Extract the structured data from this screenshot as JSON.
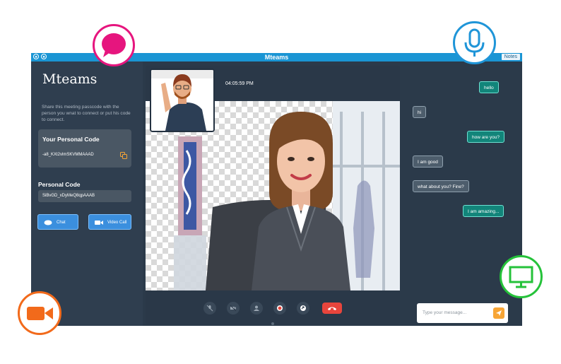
{
  "window": {
    "title": "Mteams",
    "notes_label": "Notes"
  },
  "sidebar": {
    "logo": "Mteams",
    "share_text": "Share this meeting passcode with the person you wnat to connect or put his code to connect.",
    "your_code_label": "Your Personal Code",
    "your_code_value": "-a8_KXt2vlmSKVMMAAAD",
    "personal_code_label": "Personal Code",
    "personal_code_value": "SiBvGD_xDyMeQ8qpAAAB",
    "chat_button": "Chat",
    "video_button": "Video Call"
  },
  "call": {
    "time": "04:05:59 PM"
  },
  "chat": {
    "messages": [
      {
        "from": "me",
        "text": "hello"
      },
      {
        "from": "them",
        "text": "hi"
      },
      {
        "from": "me",
        "text": "how are you?"
      },
      {
        "from": "them",
        "text": "I am good"
      },
      {
        "from": "them",
        "text": "what about you? Fine?"
      },
      {
        "from": "me",
        "text": "I am amazing..."
      }
    ],
    "input_placeholder": "Type your message..."
  },
  "icons": {
    "chat_bubble": "chat-bubble-icon",
    "microphone": "microphone-icon",
    "video_camera": "video-camera-icon",
    "monitor": "monitor-icon"
  },
  "colors": {
    "titlebar": "#1a95d4",
    "panel": "#2f3e4f",
    "button_blue": "#3b8fde",
    "bubble_me": "#12857a",
    "bubble_them": "#4d5d6c",
    "end_call": "#e8453c",
    "send": "#f7a536",
    "icon_pink": "#e6157e",
    "icon_blue": "#1f95d8",
    "icon_orange": "#f26a1b",
    "icon_green": "#25c23a"
  }
}
